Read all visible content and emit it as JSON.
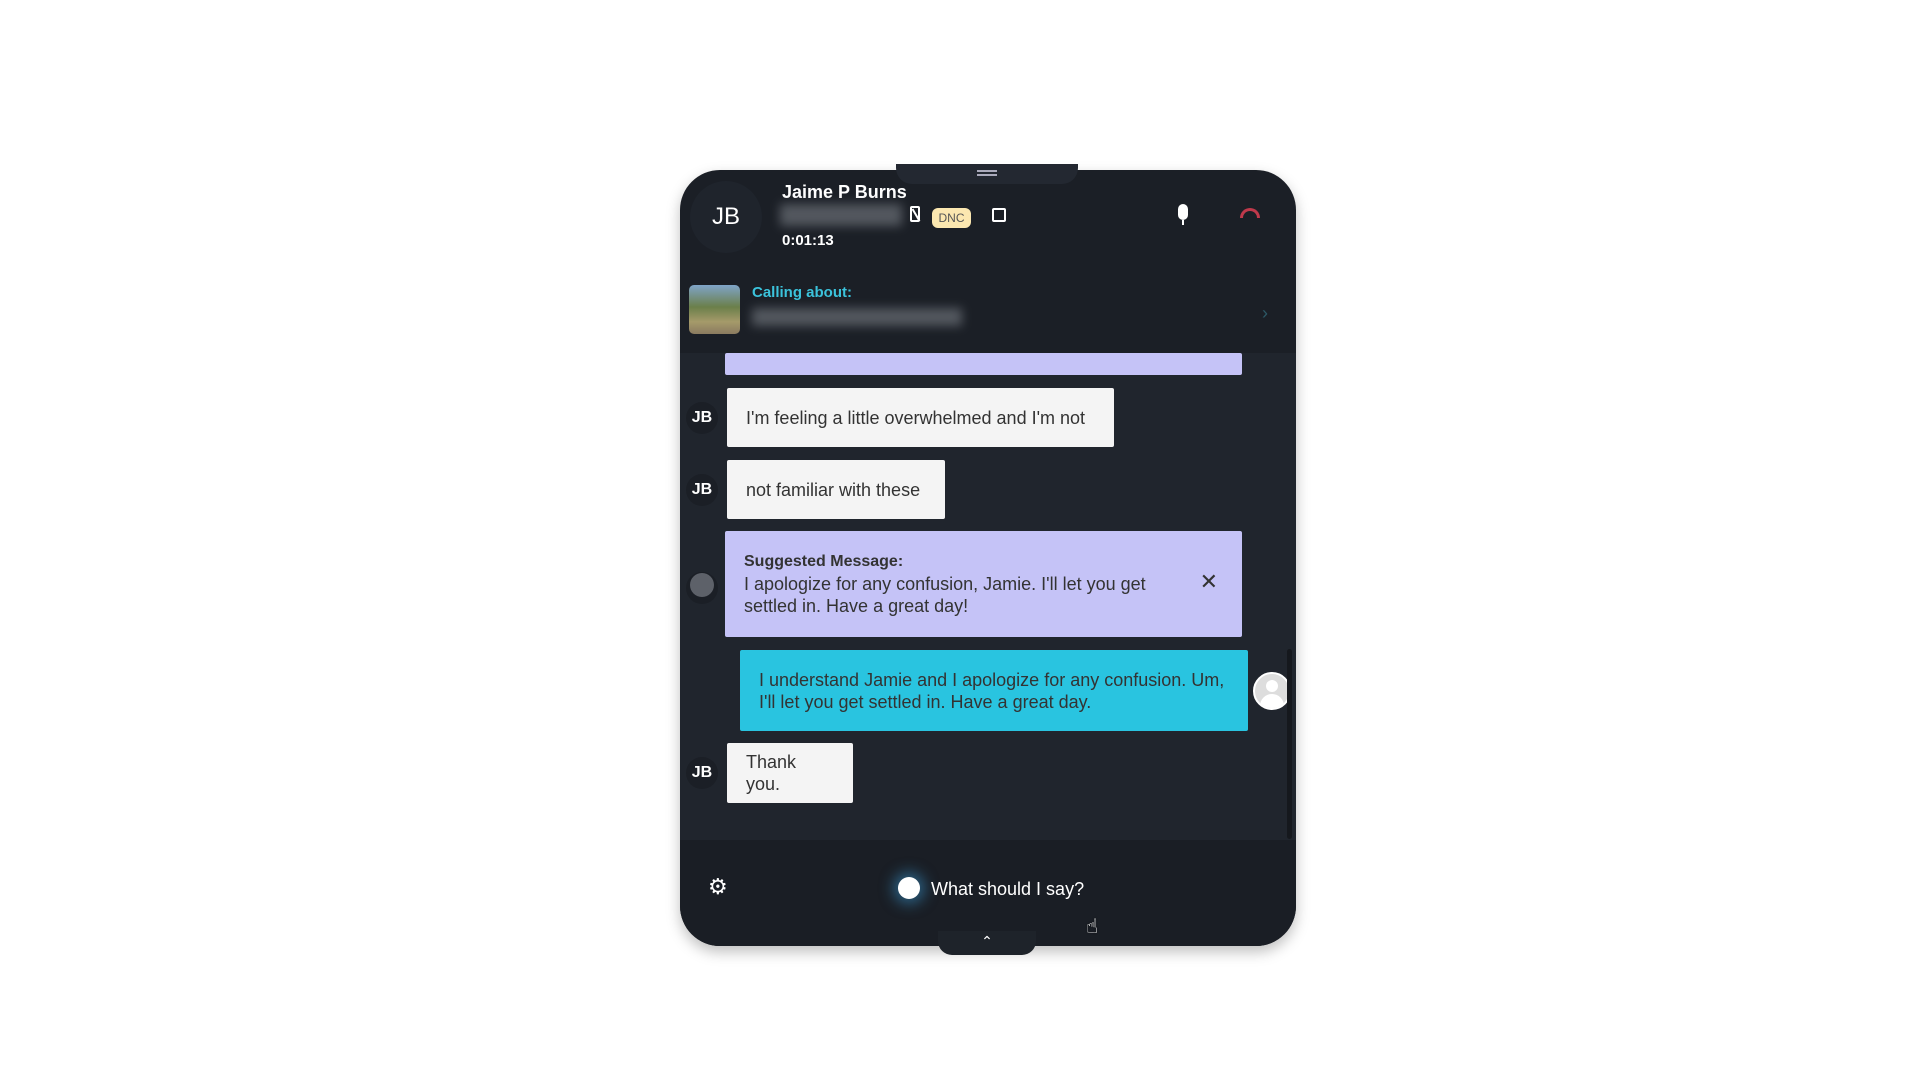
{
  "header": {
    "initials": "JB",
    "name": "Jaime P Burns",
    "dnc_badge": "DNC",
    "timer": "0:01:13",
    "calling_about_label": "Calling about:"
  },
  "messages": [
    {
      "sender": "JB",
      "text": "I'm feeling a little overwhelmed and I'm not"
    },
    {
      "sender": "JB",
      "text": "not familiar with these"
    },
    {
      "type": "suggestion",
      "title": "Suggested Message:",
      "text": "I apologize for any confusion, Jamie. I'll let you get settled in. Have a great day!"
    },
    {
      "sender": "agent",
      "text": "I understand Jamie and I apologize for any confusion. Um, I'll let you get settled in. Have a great day."
    },
    {
      "sender": "JB",
      "text": "Thank you."
    }
  ],
  "footer": {
    "prompt": "What should I say?"
  },
  "colors": {
    "panel": "#1b1f26",
    "chat": "#20252d",
    "suggestion": "#c5c3f7",
    "agent_bubble": "#29c4e0",
    "accent": "#3bc3dc",
    "hangup": "#c0394b",
    "dnc": "#fbe7b0"
  }
}
